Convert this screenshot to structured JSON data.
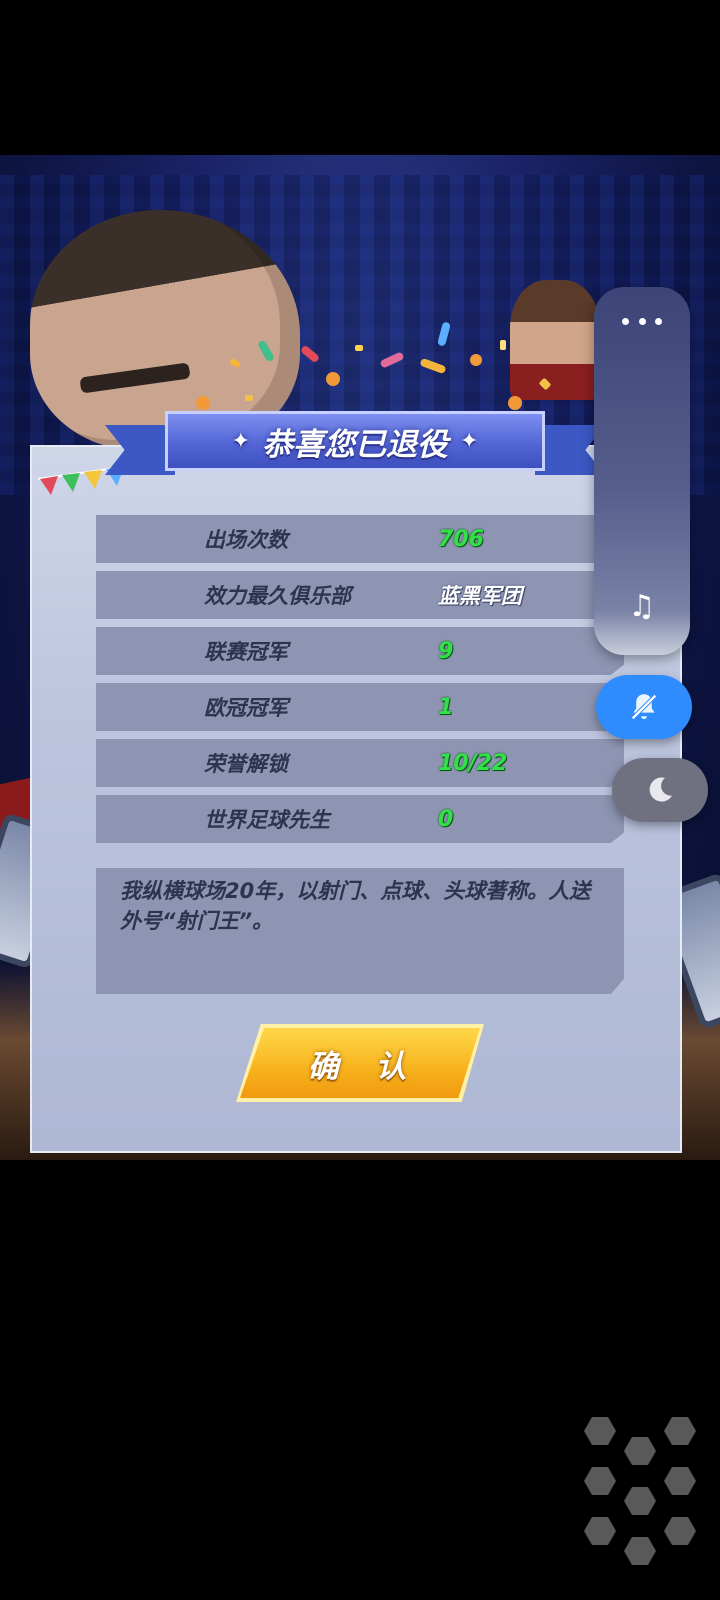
{
  "dialog": {
    "title": "恭喜您已退役",
    "stats": [
      {
        "label": "出场次数",
        "value": "706"
      },
      {
        "label": "效力最久俱乐部",
        "value": "蓝黑军团"
      },
      {
        "label": "联赛冠军",
        "value": "9"
      },
      {
        "label": "欧冠冠军",
        "value": "1"
      },
      {
        "label": "荣誉解锁",
        "value": "10/22"
      },
      {
        "label": "世界足球先生",
        "value": "0"
      }
    ],
    "bio": "我纵横球场20年，以射门、点球、头球著称。人送外号“射门王”。",
    "confirm_label": "确 认"
  },
  "side_controls": {
    "more_icon": "more-dots-icon",
    "music_icon": "music-note-icon",
    "mute_icon": "bell-muted-icon",
    "night_icon": "moon-icon",
    "mute_color": "#2f8cff"
  },
  "colors": {
    "stat_value_green": "#33e04a",
    "banner_blue": "#5466d6",
    "confirm_gold": "#f7b21c"
  }
}
